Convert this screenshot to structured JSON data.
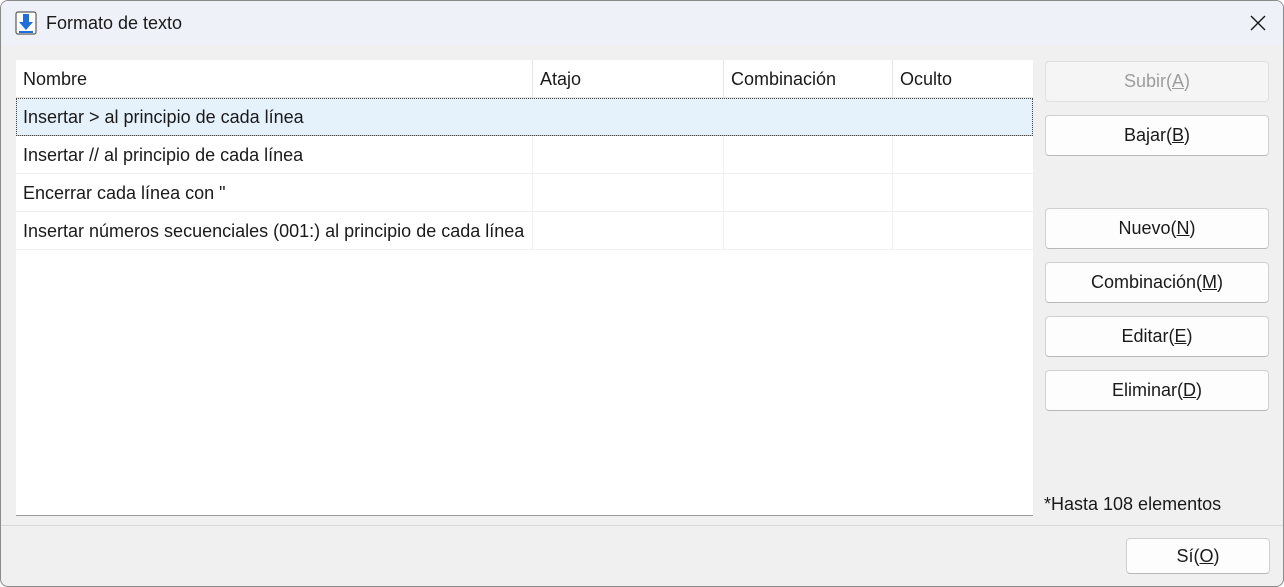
{
  "window": {
    "title": "Formato de texto",
    "icon": "download-arrow-icon"
  },
  "columns": [
    "Nombre",
    "Atajo",
    "Combinación",
    "Oculto"
  ],
  "rows": [
    {
      "name": "Insertar > al principio de cada línea",
      "shortcut": "",
      "combination": "",
      "hidden": "",
      "selected": true
    },
    {
      "name": "Insertar // al principio de cada línea",
      "shortcut": "",
      "combination": "",
      "hidden": "",
      "selected": false
    },
    {
      "name": "Encerrar cada línea con \"",
      "shortcut": "",
      "combination": "",
      "hidden": "",
      "selected": false
    },
    {
      "name": "Insertar números secuenciales (001:) al principio de cada línea",
      "shortcut": "",
      "combination": "",
      "hidden": "",
      "selected": false
    }
  ],
  "buttons": {
    "up": {
      "text": "Subir(",
      "key": "A",
      "end": ")"
    },
    "down": {
      "text": "Bajar(",
      "key": "B",
      "end": ")"
    },
    "new": {
      "text": "Nuevo(",
      "key": "N",
      "end": ")"
    },
    "combination": {
      "text": "Combinación(",
      "key": "M",
      "end": ")"
    },
    "edit": {
      "text": "Editar(",
      "key": "E",
      "end": ")"
    },
    "delete": {
      "text": "Eliminar(",
      "key": "D",
      "end": ")"
    },
    "ok": {
      "text": "Sí(",
      "key": "O",
      "end": ")"
    }
  },
  "note": "*Hasta 108 elementos",
  "colors": {
    "selection": "#e5f1fb",
    "icon_blue": "#1e6fd9"
  }
}
